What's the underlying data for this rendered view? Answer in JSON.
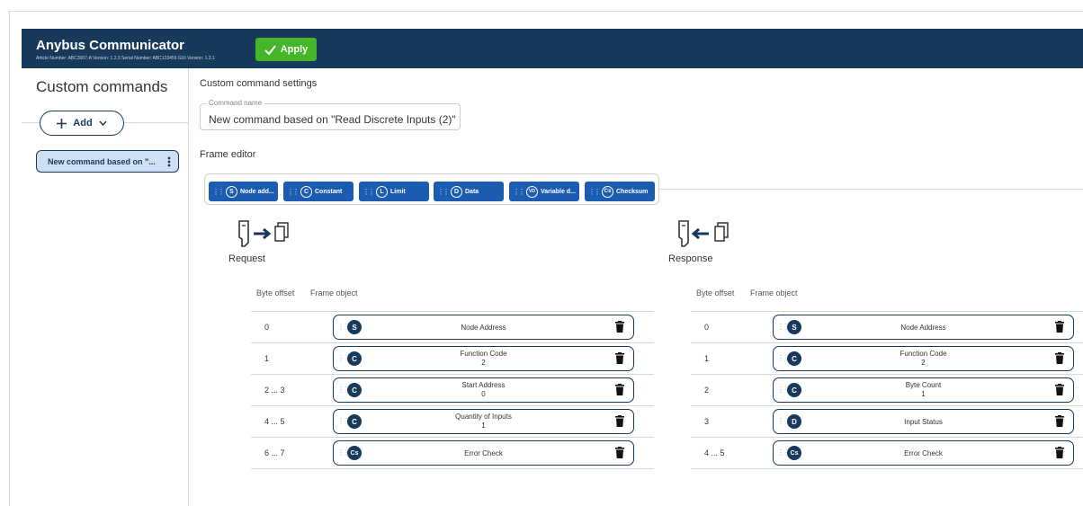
{
  "header": {
    "title": "Anybus Communicator",
    "meta": "Article Number: ABC3007-A Version: 1.2.3 Serial Number: ABC123456 GUI Version: 1.3.1",
    "apply_label": "Apply"
  },
  "sidebar": {
    "title": "Custom commands",
    "add_label": "Add",
    "commands": [
      {
        "label": "New command based on \"..."
      }
    ]
  },
  "main": {
    "settings_title": "Custom command settings",
    "command_name_label": "Command name",
    "command_name_value": "New command based on \"Read Discrete Inputs (2)\"",
    "frame_editor_title": "Frame editor",
    "palette": [
      {
        "code": "S",
        "label": "Node add..."
      },
      {
        "code": "C",
        "label": "Constant"
      },
      {
        "code": "L",
        "label": "Limit"
      },
      {
        "code": "D",
        "label": "Data"
      },
      {
        "code": "VD",
        "label": "Variable d..."
      },
      {
        "code": "Cs",
        "label": "Checksum"
      }
    ]
  },
  "request": {
    "title": "Request",
    "col_offset": "Byte offset",
    "col_object": "Frame object",
    "rows": [
      {
        "offset": "0",
        "code": "S",
        "name": "Node Address",
        "value": ""
      },
      {
        "offset": "1",
        "code": "C",
        "name": "Function Code",
        "value": "2"
      },
      {
        "offset": "2 ... 3",
        "code": "C",
        "name": "Start Address",
        "value": "0"
      },
      {
        "offset": "4 ... 5",
        "code": "C",
        "name": "Quantity of Inputs",
        "value": "1"
      },
      {
        "offset": "6 ... 7",
        "code": "Cs",
        "name": "Error Check",
        "value": ""
      }
    ]
  },
  "response": {
    "title": "Response",
    "col_offset": "Byte offset",
    "col_object": "Frame object",
    "rows": [
      {
        "offset": "0",
        "code": "S",
        "name": "Node Address",
        "value": ""
      },
      {
        "offset": "1",
        "code": "C",
        "name": "Function Code",
        "value": "2"
      },
      {
        "offset": "2",
        "code": "C",
        "name": "Byte Count",
        "value": "1"
      },
      {
        "offset": "3",
        "code": "D",
        "name": "Input Status",
        "value": ""
      },
      {
        "offset": "4 ... 5",
        "code": "Cs",
        "name": "Error Check",
        "value": ""
      }
    ]
  },
  "colors": {
    "header_bg": "#17395b",
    "apply_bg": "#45b52a",
    "chip_bg": "#1b5cb0",
    "selected_bg": "#cfe0f4"
  }
}
